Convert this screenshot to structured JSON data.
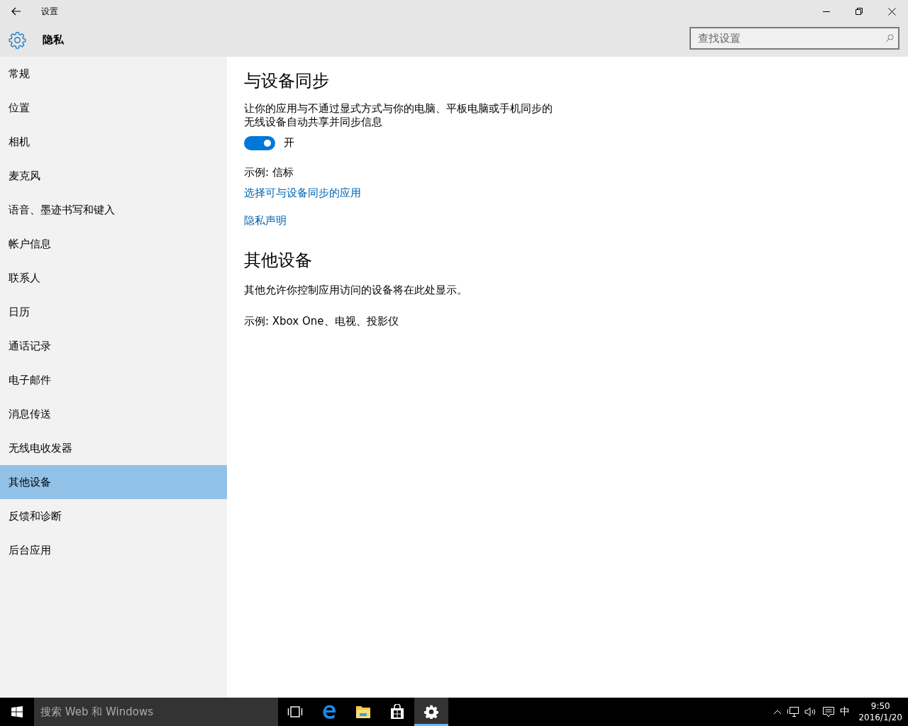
{
  "window": {
    "title": "设置",
    "section": "隐私"
  },
  "search": {
    "placeholder": "查找设置"
  },
  "sidebar": {
    "items": [
      {
        "label": "常规",
        "selected": false
      },
      {
        "label": "位置",
        "selected": false
      },
      {
        "label": "相机",
        "selected": false
      },
      {
        "label": "麦克风",
        "selected": false
      },
      {
        "label": "语音、墨迹书写和键入",
        "selected": false
      },
      {
        "label": "帐户信息",
        "selected": false
      },
      {
        "label": "联系人",
        "selected": false
      },
      {
        "label": "日历",
        "selected": false
      },
      {
        "label": "通话记录",
        "selected": false
      },
      {
        "label": "电子邮件",
        "selected": false
      },
      {
        "label": "消息传送",
        "selected": false
      },
      {
        "label": "无线电收发器",
        "selected": false
      },
      {
        "label": "其他设备",
        "selected": true
      },
      {
        "label": "反馈和诊断",
        "selected": false
      },
      {
        "label": "后台应用",
        "selected": false
      }
    ]
  },
  "content": {
    "blocks": [
      {
        "kind": "heading",
        "text": "与设备同步"
      },
      {
        "kind": "paragraph",
        "text": "让你的应用与不通过显式方式与你的电脑、平板电脑或手机同步的"
      },
      {
        "kind": "line",
        "text": "无线设备自动共享并同步信息"
      },
      {
        "kind": "toggle",
        "on": true,
        "label": "开"
      },
      {
        "kind": "paragraph",
        "text": "示例: 信标"
      },
      {
        "kind": "link",
        "text": "选择可与设备同步的应用"
      },
      {
        "kind": "link",
        "text": "隐私声明"
      },
      {
        "kind": "heading",
        "text": "其他设备"
      },
      {
        "kind": "paragraph",
        "text": "其他允许你控制应用访问的设备将在此处显示。"
      },
      {
        "kind": "paragraph",
        "text": "示例: Xbox One、电视、投影仪"
      }
    ]
  },
  "taskbar": {
    "search_placeholder": "搜索 Web 和 Windows",
    "apps": [
      {
        "kind": "taskview",
        "selected": false
      },
      {
        "kind": "edge",
        "selected": false
      },
      {
        "kind": "folder",
        "selected": false
      },
      {
        "kind": "store",
        "selected": false
      },
      {
        "kind": "settings",
        "selected": true
      }
    ],
    "input_method": "中",
    "time": "9:50",
    "date": "2016/1/20"
  }
}
